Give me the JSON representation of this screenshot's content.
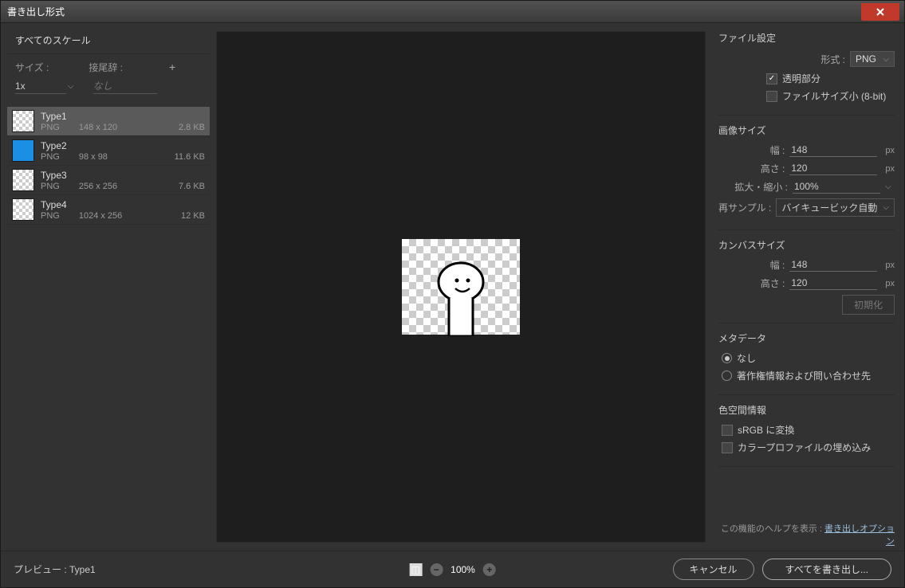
{
  "window": {
    "title": "書き出し形式"
  },
  "scale_panel": {
    "title": "すべてのスケール",
    "size_label": "サイズ :",
    "suffix_label": "接尾辞 :",
    "size_value": "1x",
    "suffix_placeholder": "なし"
  },
  "artboards": [
    {
      "name": "Type1",
      "format": "PNG",
      "dims": "148 x 120",
      "filesize": "2.8 KB",
      "selected": true,
      "thumb": "checker"
    },
    {
      "name": "Type2",
      "format": "PNG",
      "dims": "98 x 98",
      "filesize": "11.6 KB",
      "selected": false,
      "thumb": "blue"
    },
    {
      "name": "Type3",
      "format": "PNG",
      "dims": "256 x 256",
      "filesize": "7.6 KB",
      "selected": false,
      "thumb": "checker"
    },
    {
      "name": "Type4",
      "format": "PNG",
      "dims": "1024 x 256",
      "filesize": "12 KB",
      "selected": false,
      "thumb": "checker"
    }
  ],
  "file_settings": {
    "title": "ファイル設定",
    "format_label": "形式 :",
    "format_value": "PNG",
    "transparency_label": "透明部分",
    "transparency_checked": true,
    "small_file_label": "ファイルサイズ小 (8-bit)",
    "small_file_checked": false
  },
  "image_size": {
    "title": "画像サイズ",
    "width_label": "幅 :",
    "width_value": "148",
    "height_label": "高さ :",
    "height_value": "120",
    "scale_label": "拡大・縮小 :",
    "scale_value": "100%",
    "resample_label": "再サンプル :",
    "resample_value": "バイキュービック自動",
    "unit": "px"
  },
  "canvas_size": {
    "title": "カンバスサイズ",
    "width_label": "幅 :",
    "width_value": "148",
    "height_label": "高さ :",
    "height_value": "120",
    "unit": "px",
    "reset_label": "初期化"
  },
  "metadata": {
    "title": "メタデータ",
    "none_label": "なし",
    "copyright_label": "著作権情報および問い合わせ先",
    "selected": "none"
  },
  "color_space": {
    "title": "色空間情報",
    "srgb_label": "sRGB に変換",
    "srgb_checked": false,
    "embed_label": "カラープロファイルの埋め込み",
    "embed_checked": false
  },
  "help": {
    "prefix": "この機能のヘルプを表示 : ",
    "link": "書き出しオプション"
  },
  "footer": {
    "preview_label": "プレビュー : Type1",
    "zoom": "100%",
    "cancel": "キャンセル",
    "export_all": "すべてを書き出し..."
  }
}
